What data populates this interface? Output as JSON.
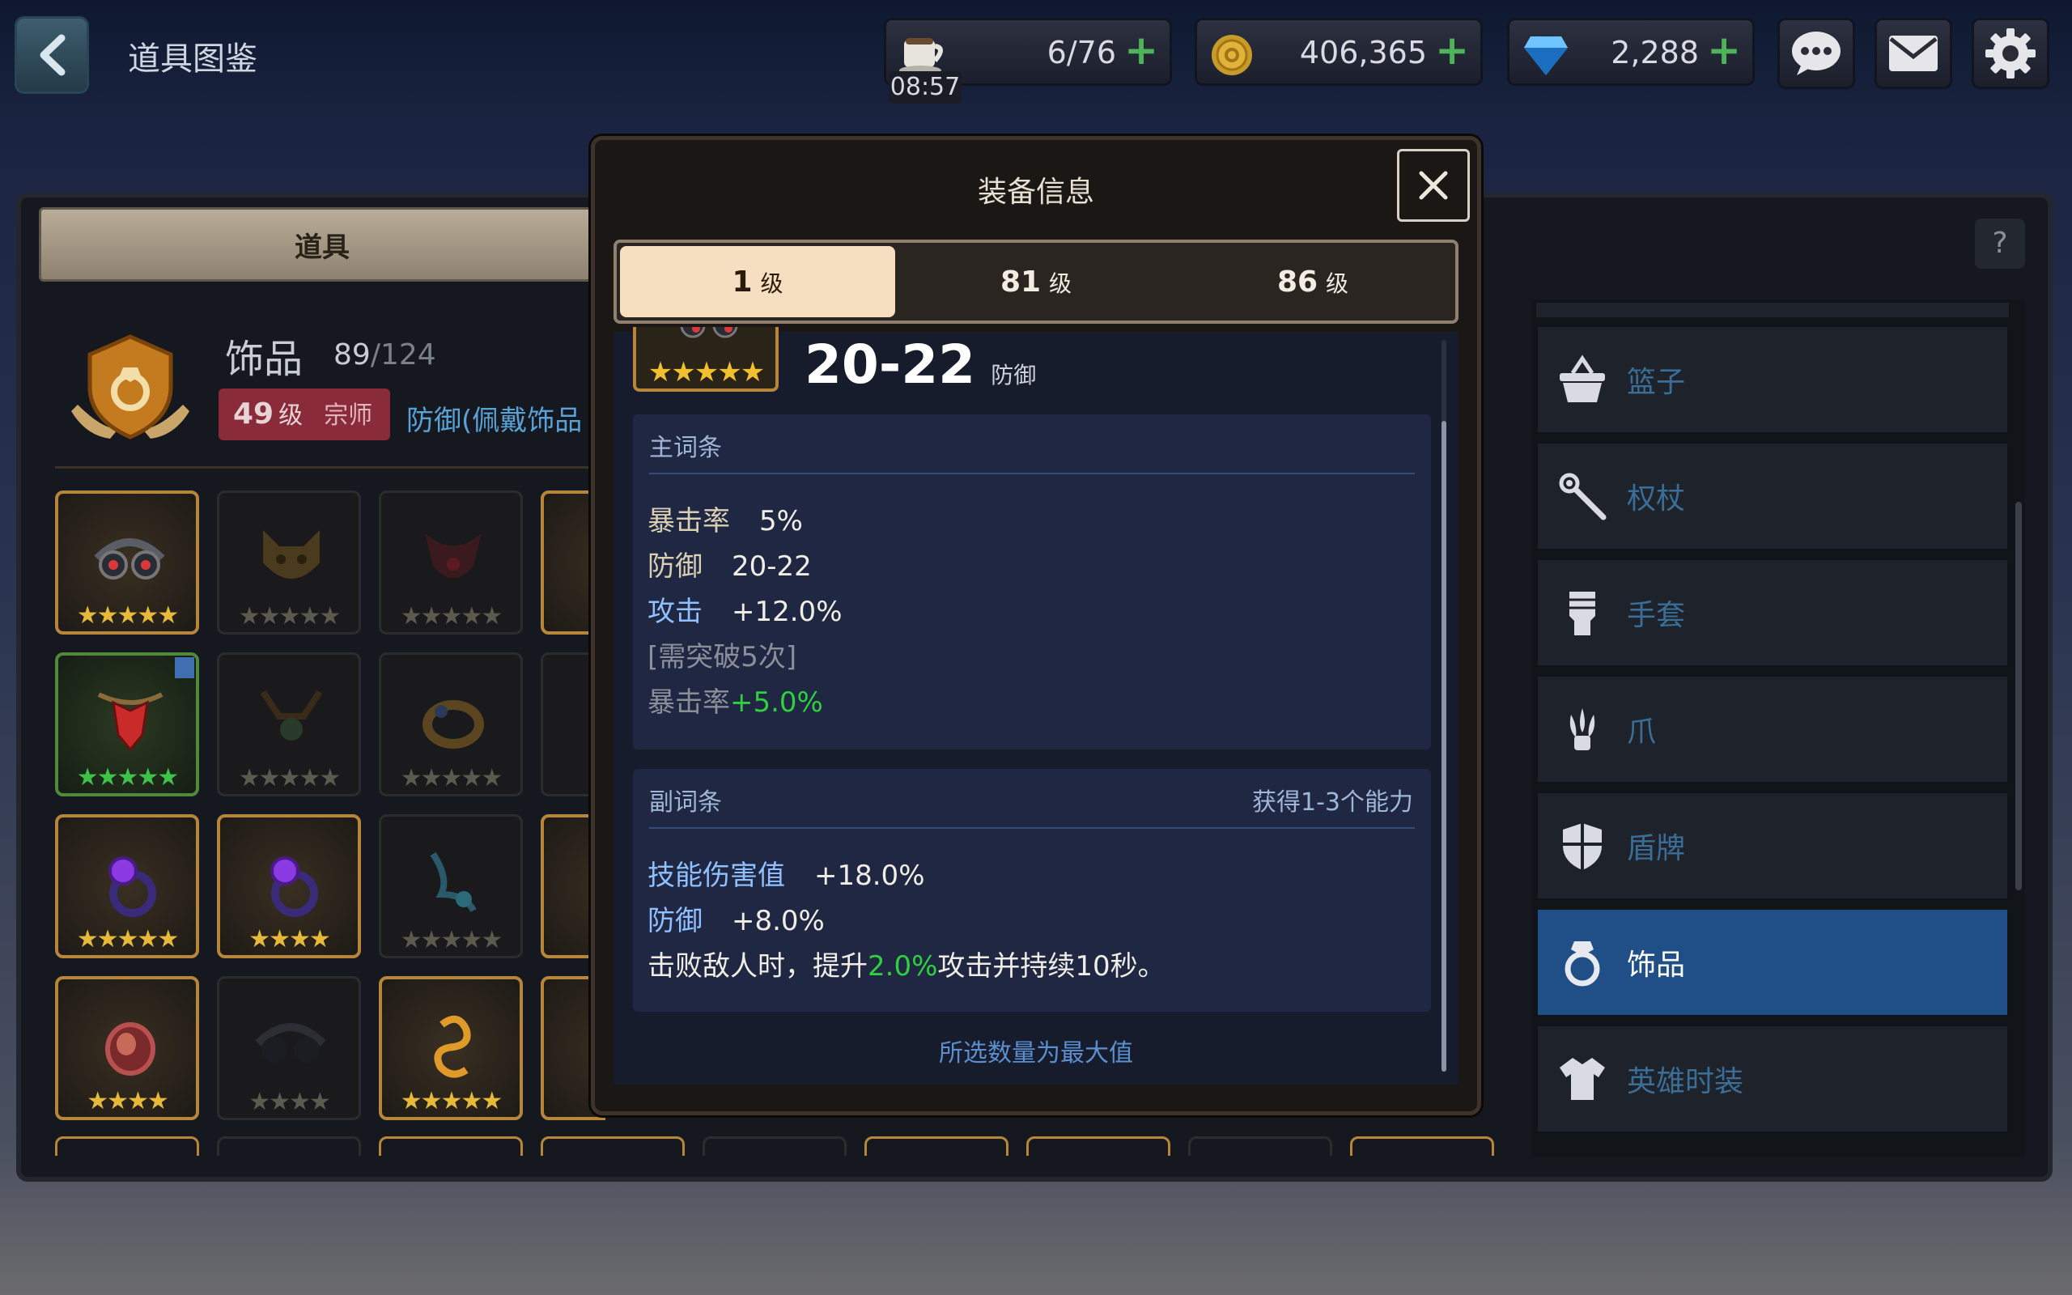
{
  "header": {
    "title": "道具图鉴",
    "stamina": {
      "value": "6/76",
      "timer": "08:57"
    },
    "gold": {
      "value": "406,365"
    },
    "gems": {
      "value": "2,288"
    }
  },
  "left_panel": {
    "tab_label": "道具",
    "category": {
      "name": "饰品",
      "count": "89",
      "total": "/124",
      "level": "49",
      "level_unit": "级",
      "rank": "宗师",
      "bonus": "防御(佩戴饰品"
    },
    "grid_stars": [
      [
        "★★★★★",
        "★★★★★",
        "★★★★★"
      ],
      [
        "★★★★★",
        "★★★★★",
        "★★★★★"
      ],
      [
        "★★★★★",
        "★★★★",
        "★★★★★"
      ],
      [
        "★★★★",
        "★★★★",
        "★★★★★"
      ]
    ]
  },
  "modal": {
    "title": "装备信息",
    "tabs": [
      {
        "num": "1",
        "unit": "级"
      },
      {
        "num": "81",
        "unit": "级"
      },
      {
        "num": "86",
        "unit": "级"
      }
    ],
    "item": {
      "stars": "★★★★★",
      "range": "20-22",
      "stat": "防御"
    },
    "main_affix": {
      "title": "主词条",
      "rows": [
        {
          "key": "暴击率",
          "value": "5%"
        },
        {
          "key": "防御",
          "value": "20-22"
        },
        {
          "key": "攻击",
          "value": "+12.0%"
        }
      ],
      "breakthrough_note": "[需突破5次]",
      "bonus_key": "暴击率",
      "bonus_value": "+5.0%"
    },
    "sub_affix": {
      "title": "副词条",
      "hint": "获得1-3个能力",
      "rows": [
        {
          "key": "技能伤害值",
          "value": "+18.0%"
        },
        {
          "key": "防御",
          "value": "+8.0%"
        }
      ],
      "effect_pre": "击败敌人时，提升",
      "effect_value": "2.0%",
      "effect_post": "攻击并持续10秒。"
    },
    "footer_note": "所选数量为最大值"
  },
  "right_menu": {
    "help": "?",
    "items": [
      {
        "label": "篮子",
        "icon": "basket-icon"
      },
      {
        "label": "权杖",
        "icon": "scepter-icon"
      },
      {
        "label": "手套",
        "icon": "gauntlet-icon"
      },
      {
        "label": "爪",
        "icon": "claw-icon"
      },
      {
        "label": "盾牌",
        "icon": "shield-icon"
      },
      {
        "label": "饰品",
        "icon": "ring-icon"
      },
      {
        "label": "英雄时装",
        "icon": "costume-icon"
      }
    ]
  },
  "colors": {
    "accent_green": "#2ed03e",
    "active_blue": "#1f4f86",
    "tab_selected": "#f6dfc0"
  }
}
